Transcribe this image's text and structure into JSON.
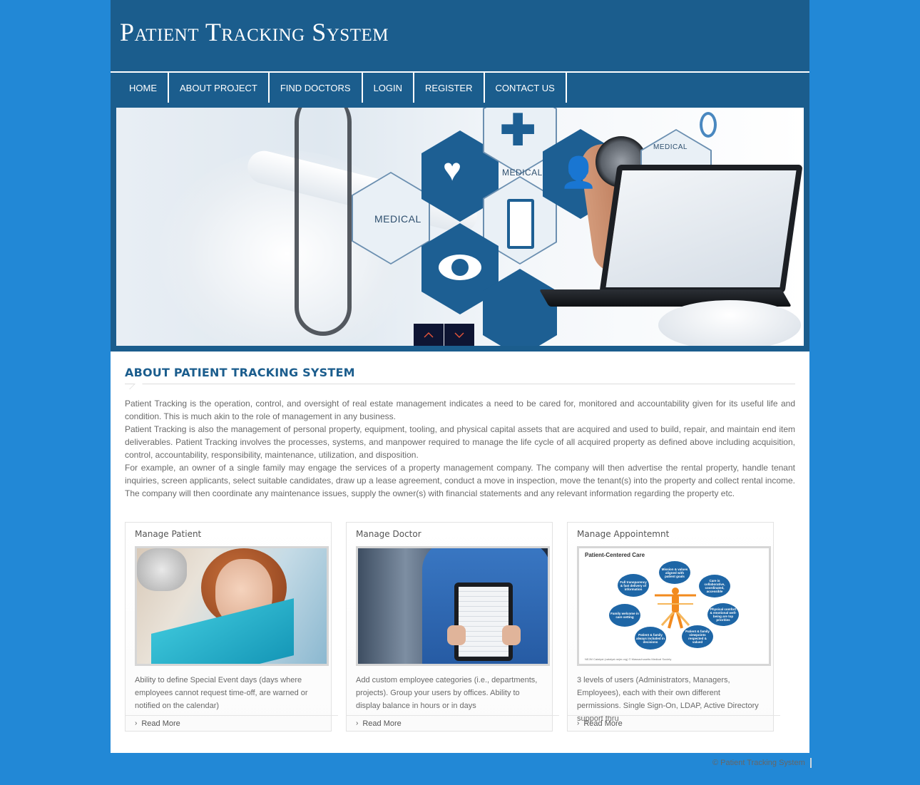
{
  "header": {
    "site_title": "Patient Tracking System"
  },
  "nav": {
    "items": [
      {
        "label": "HOME"
      },
      {
        "label": "ABOUT PROJECT"
      },
      {
        "label": "FIND DOCTORS"
      },
      {
        "label": "LOGIN"
      },
      {
        "label": "REGISTER"
      },
      {
        "label": "CONTACT US"
      }
    ]
  },
  "banner": {
    "hex_labels": [
      "MEDICAL",
      "MEDICAL",
      "MEDICAL"
    ],
    "prev_icon": "chevron-up-icon",
    "next_icon": "chevron-down-icon",
    "arrow_color": "#e8553a"
  },
  "about": {
    "title": "ABOUT PATIENT TRACKING SYSTEM",
    "paragraphs": [
      "Patient Tracking is the operation, control, and oversight of real estate management indicates a need to be cared for, monitored and accountability given for its useful life and condition. This is much akin to the role of management in any business.",
      "Patient Tracking is also the management of personal property, equipment, tooling, and physical capital assets that are acquired and used to build, repair, and maintain end item deliverables. Patient Tracking involves the processes, systems, and manpower required to manage the life cycle of all acquired property as defined above including acquisition, control, accountability, responsibility, maintenance, utilization, and disposition.",
      "For example, an owner of a single family may engage the services of a property management company. The company will then advertise the rental property, handle tenant inquiries, screen applicants, select suitable candidates, draw up a lease agreement, conduct a move in inspection, move the tenant(s) into the property and collect rental income. The company will then coordinate any maintenance issues, supply the owner(s) with financial statements and any relevant information regarding the property etc."
    ]
  },
  "cards": [
    {
      "title": "Manage Patient",
      "text": "Ability to define Special Event days (days where employees cannot request time-off, are warned or notified on the calendar)",
      "link": "Read More"
    },
    {
      "title": "Manage Doctor",
      "text": "Add custom employee categories (i.e., departments, projects). Group your users by offices. Ability to display balance in hours or in days",
      "link": "Read More"
    },
    {
      "title": "Manage Appointemnt",
      "text": "3 levels of users (Administrators, Managers, Employees), each with their own different permissions. Single Sign-On, LDAP, Active Directory support thru",
      "link": "Read More",
      "image": {
        "title": "Patient-Centered Care",
        "circles": [
          "Mission & values aligned with patient goals",
          "Care is collaborative, coordinated, accessible",
          "Physical comfort & emotional well-being are top priorities",
          "Patient & family viewpoints respected & valued",
          "Patient & family always included in decisions",
          "Family welcome in care setting",
          "Full transparency & fast delivery of information"
        ],
        "credit": "NEJM Catalyst (catalyst.nejm.org) © Massachusetts Medical Society"
      }
    }
  ],
  "footer": {
    "copyright": "© Patient Tracking System"
  },
  "colors": {
    "page_bg": "#2288d6",
    "header_bg": "#1b5d8d",
    "title_blue": "#1b5d8d",
    "slider_btn": "#0e1533"
  }
}
